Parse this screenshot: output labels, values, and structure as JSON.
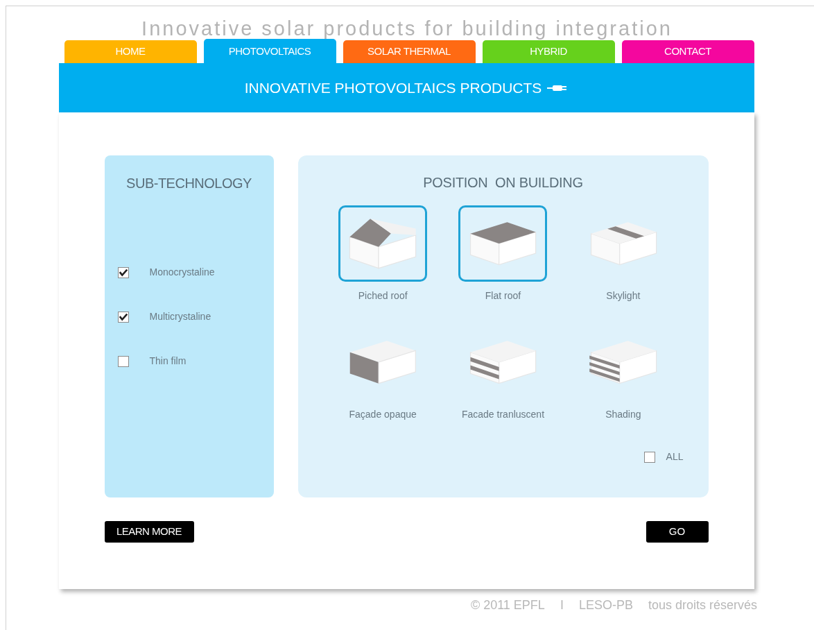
{
  "site_title": "Innovative solar products for building integration",
  "tabs": [
    {
      "label": "HOME",
      "selected": false,
      "color": "#ffb400"
    },
    {
      "label": "PHOTOVOLTAICS",
      "selected": true,
      "color": "#00aeef"
    },
    {
      "label": "SOLAR THERMAL",
      "selected": false,
      "color": "#ff6a13"
    },
    {
      "label": "HYBRID",
      "selected": false,
      "color": "#66d11c"
    },
    {
      "label": "CONTACT",
      "selected": false,
      "color": "#f4079e"
    }
  ],
  "banner": {
    "title": "INNOVATIVE PHOTOVOLTAICS PRODUCTS"
  },
  "sub_technology": {
    "title": "SUB-TECHNOLOGY",
    "options": [
      {
        "label": "Monocrystaline",
        "checked": true
      },
      {
        "label": "Multicrystaline",
        "checked": true
      },
      {
        "label": "Thin film",
        "checked": false
      }
    ]
  },
  "position": {
    "title": "POSITION  ON BUILDING",
    "items": [
      {
        "label": "Piched roof",
        "kind": "pitched",
        "selected": true
      },
      {
        "label": "Flat roof",
        "kind": "flat",
        "selected": true
      },
      {
        "label": "Skylight",
        "kind": "skylight",
        "selected": false
      },
      {
        "label": "Façade opaque",
        "kind": "facade",
        "selected": false
      },
      {
        "label": "Facade tranluscent",
        "kind": "translucent",
        "selected": false
      },
      {
        "label": "Shading",
        "kind": "shading",
        "selected": false
      }
    ],
    "all": {
      "label": "ALL",
      "checked": false
    }
  },
  "buttons": {
    "learn_more": "LEARN MORE",
    "go": "GO"
  },
  "footer": [
    "© 2011 EPFL",
    "I",
    "LESO-PB",
    "tous droits réservés"
  ]
}
